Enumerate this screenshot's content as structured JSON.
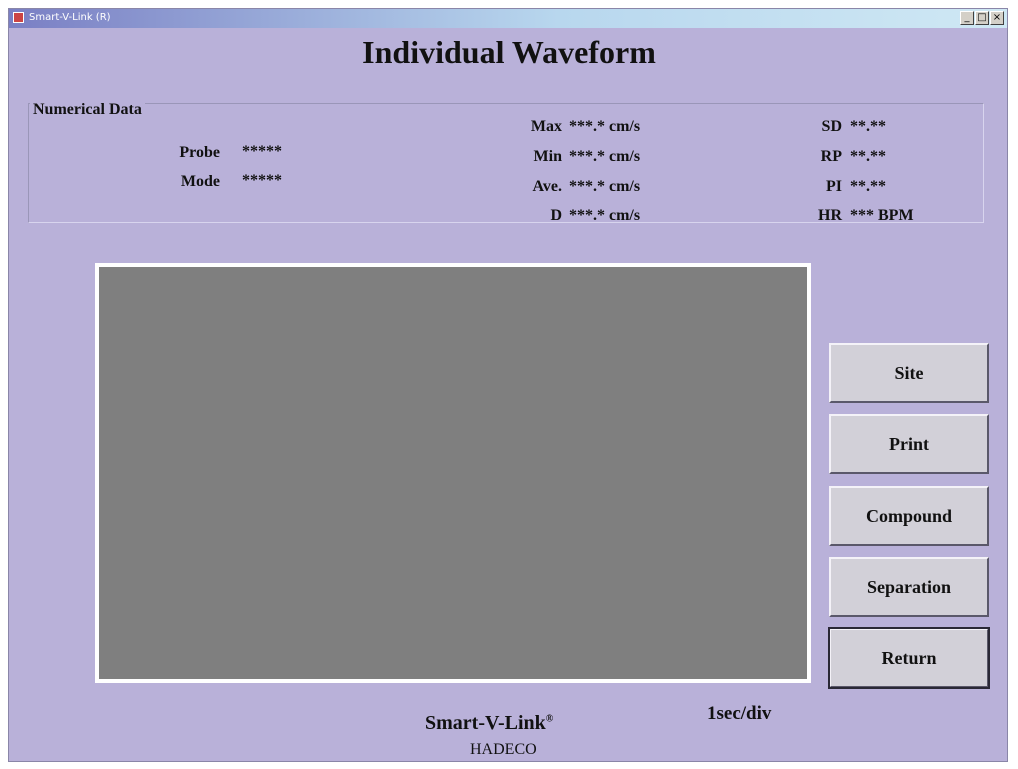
{
  "window": {
    "title": "Smart-V-Link (R)",
    "controls": [
      "_",
      "□",
      "×"
    ]
  },
  "headline": "Individual Waveform",
  "numerical_data": {
    "legend": "Numerical Data",
    "probe_label": "Probe",
    "probe_value": "*****",
    "mode_label": "Mode",
    "mode_value": "*****",
    "max_label": "Max",
    "max_value": "***.* cm/s",
    "min_label": "Min",
    "min_value": "***.* cm/s",
    "ave_label": "Ave.",
    "ave_value": "***.* cm/s",
    "d_label": "D",
    "d_value": "***.* cm/s",
    "sd_label": "SD",
    "sd_value": "**.**",
    "rp_label": "RP",
    "rp_value": "**.**",
    "pi_label": "PI",
    "pi_value": "**.**",
    "hr_label": "HR",
    "hr_value": "*** BPM"
  },
  "buttons": {
    "site": "Site",
    "print": "Print",
    "compound": "Compound",
    "separation": "Separation",
    "return": "Return"
  },
  "footer": {
    "brand": "Smart-V-Link",
    "brand_mark": "®",
    "timescale": "1sec/div",
    "maker": "HADECO"
  }
}
